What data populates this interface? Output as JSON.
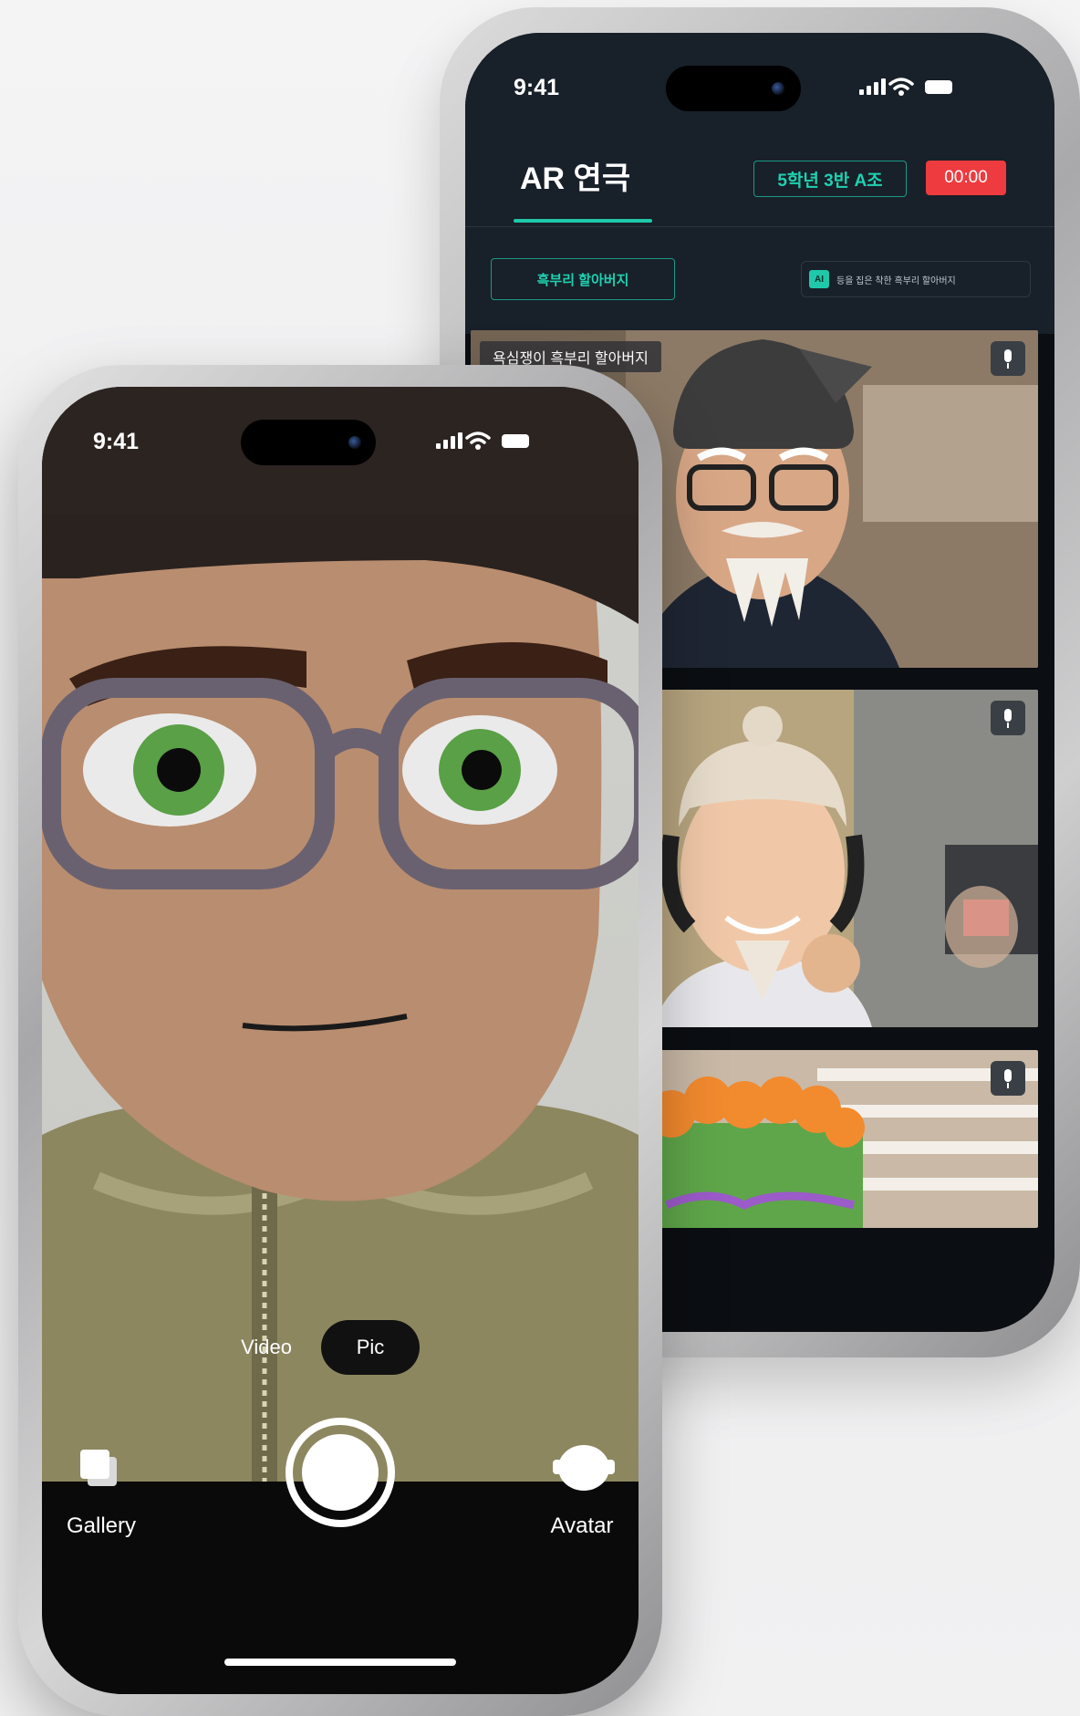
{
  "back_phone": {
    "status_time": "9:41",
    "title": "AR 연극",
    "class_badge": "5학년 3반 A조",
    "timer": "00:00",
    "role_button": "흑부리 할아버지",
    "role_info": {
      "tag": "AI",
      "text": "등을 집은 착한 흑부리 할아버지"
    },
    "tiles": [
      {
        "label": "욕심쟁이 흑부리 할아버지",
        "mic": "mic-icon"
      },
      {
        "mic": "mic-icon"
      },
      {
        "mic": "mic-icon"
      }
    ],
    "colors": {
      "accent": "#1fc8a9",
      "timer_bg": "#ee3b3f",
      "header_bg": "#182029"
    }
  },
  "front_phone": {
    "status_time": "9:41",
    "modes": [
      {
        "label": "Video",
        "selected": false
      },
      {
        "label": "Pic",
        "selected": true
      }
    ],
    "gallery_label": "Gallery",
    "avatar_label": "Avatar",
    "icons": [
      "gallery-icon",
      "shutter-button",
      "avatar-icon"
    ]
  }
}
